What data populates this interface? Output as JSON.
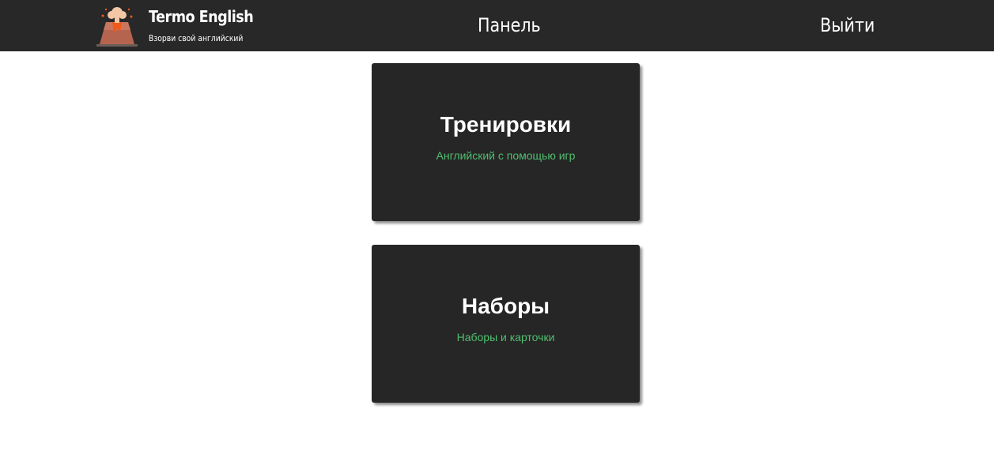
{
  "header": {
    "brand_title": "Termo English",
    "brand_subtitle": "Взорви свой английский",
    "logo_icon": "volcano-icon",
    "nav_panel": "Панель",
    "nav_logout": "Выйти",
    "background_color": "#282828"
  },
  "cards": [
    {
      "title": "Тренировки",
      "description": "Английский с помощью игр"
    },
    {
      "title": "Наборы",
      "description": "Наборы и карточки"
    }
  ],
  "colors": {
    "card_background": "#262626",
    "accent_green": "#4fbf6f",
    "text_white": "#ffffff"
  }
}
